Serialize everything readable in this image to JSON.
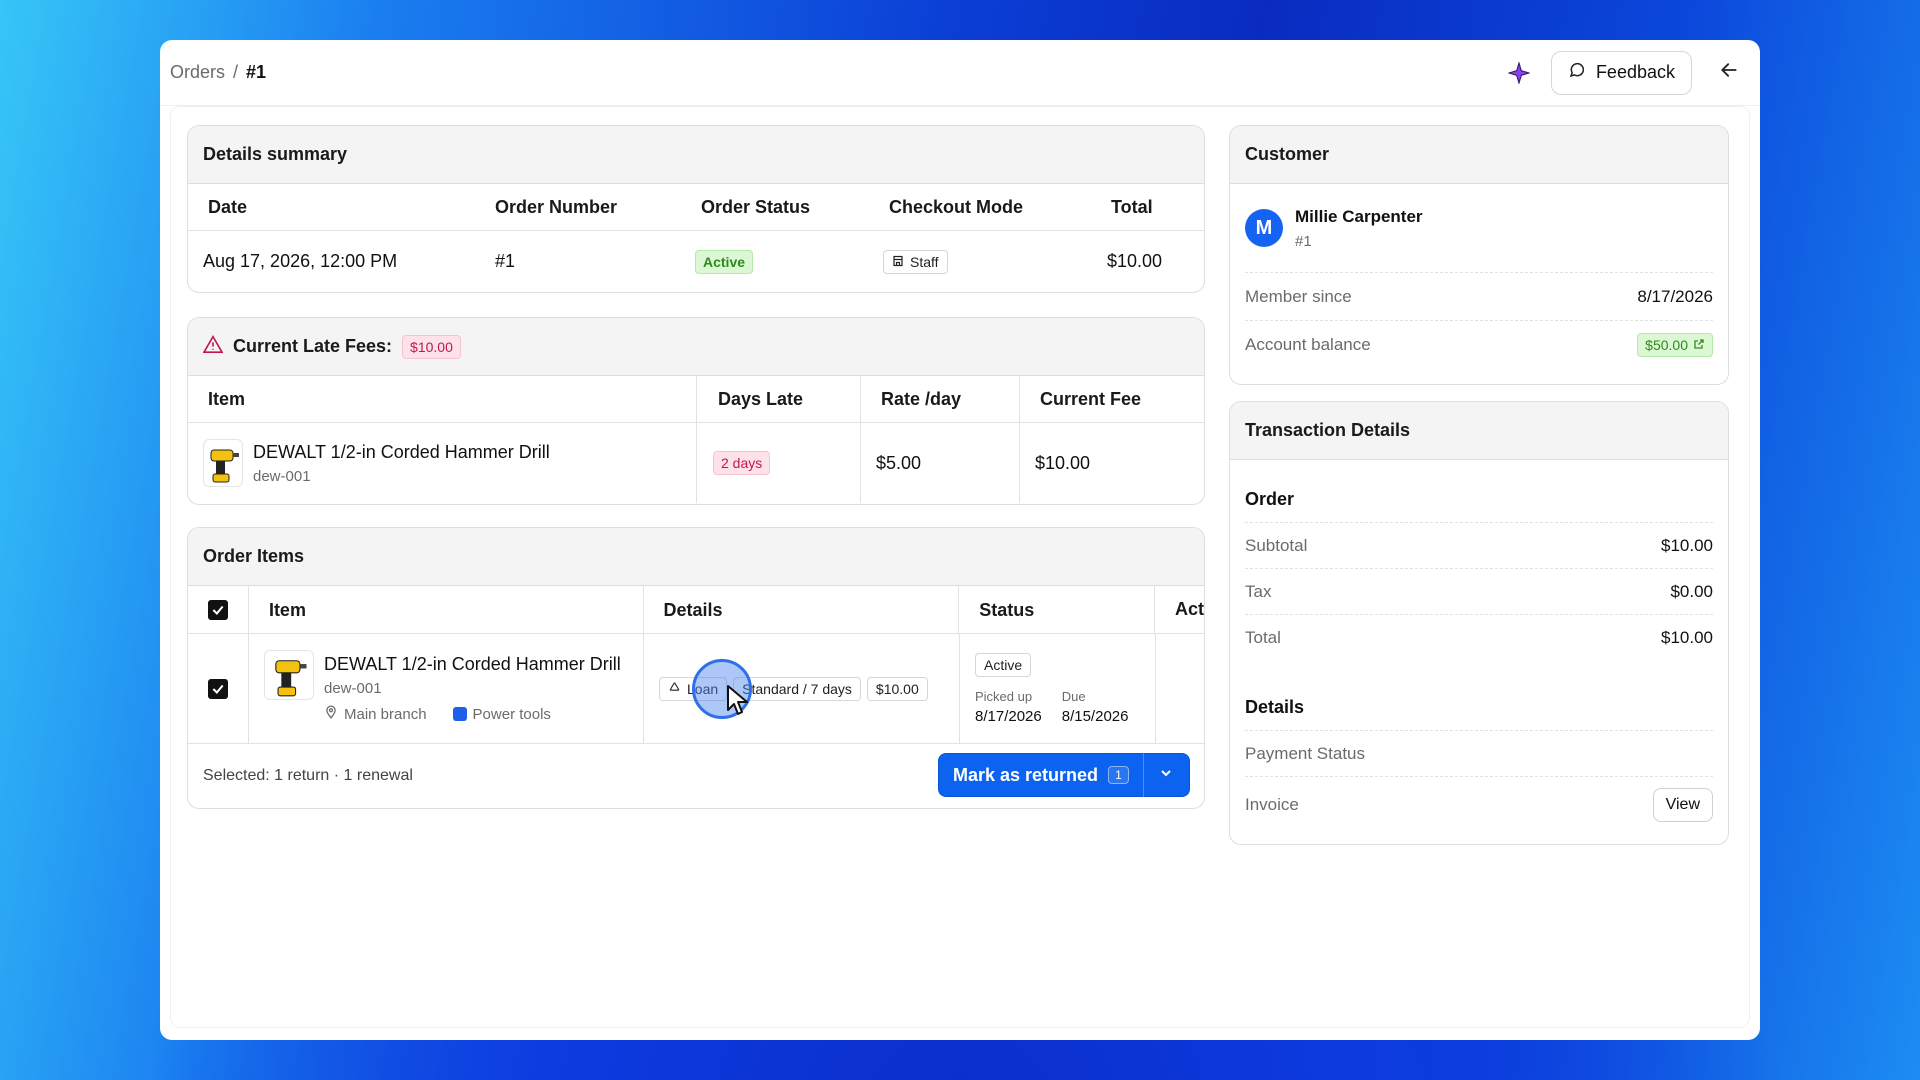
{
  "breadcrumb": {
    "parent": "Orders",
    "separator": "/",
    "current": "#1"
  },
  "header": {
    "feedback_label": "Feedback"
  },
  "summary": {
    "title": "Details summary",
    "columns": [
      "Date",
      "Order Number",
      "Order Status",
      "Checkout Mode",
      "Total"
    ],
    "date": "Aug 17, 2026, 12:00 PM",
    "order_number": "#1",
    "status": "Active",
    "checkout_mode": "Staff",
    "total": "$10.00"
  },
  "late_fees": {
    "title": "Current Late Fees:",
    "badge": "$10.00",
    "columns": [
      "Item",
      "Days Late",
      "Rate /day",
      "Current Fee"
    ],
    "item_name": "DEWALT 1/2-in Corded Hammer Drill",
    "item_sku": "dew-001",
    "days_late": "2 days",
    "rate": "$5.00",
    "current_fee": "$10.00"
  },
  "order_items": {
    "title": "Order Items",
    "columns": [
      "Item",
      "Details",
      "Status",
      "Act"
    ],
    "item_name": "DEWALT 1/2-in Corded Hammer Drill",
    "item_sku": "dew-001",
    "location": "Main branch",
    "category": "Power tools",
    "type": "Loan",
    "plan": "Standard / 7 days",
    "price": "$10.00",
    "status": "Active",
    "picked_up_label": "Picked up",
    "picked_up": "8/17/2026",
    "due_label": "Due",
    "due": "8/15/2026",
    "selected_summary": "Selected: 1 return · 1 renewal",
    "action_label": "Mark as returned",
    "action_count": "1"
  },
  "customer": {
    "title": "Customer",
    "avatar_initial": "M",
    "name": "Millie Carpenter",
    "id": "#1",
    "member_since_label": "Member since",
    "member_since": "8/17/2026",
    "balance_label": "Account balance",
    "balance": "$50.00"
  },
  "transaction": {
    "title": "Transaction Details",
    "order_heading": "Order",
    "subtotal_label": "Subtotal",
    "subtotal": "$10.00",
    "tax_label": "Tax",
    "tax": "$0.00",
    "total_label": "Total",
    "total": "$10.00",
    "details_heading": "Details",
    "payment_status_label": "Payment Status",
    "invoice_label": "Invoice",
    "view_label": "View"
  },
  "colors": {
    "accent": "#0b63f0",
    "success": "#2f8a1d",
    "danger": "#c4174b",
    "avatar": "#1463f3"
  }
}
